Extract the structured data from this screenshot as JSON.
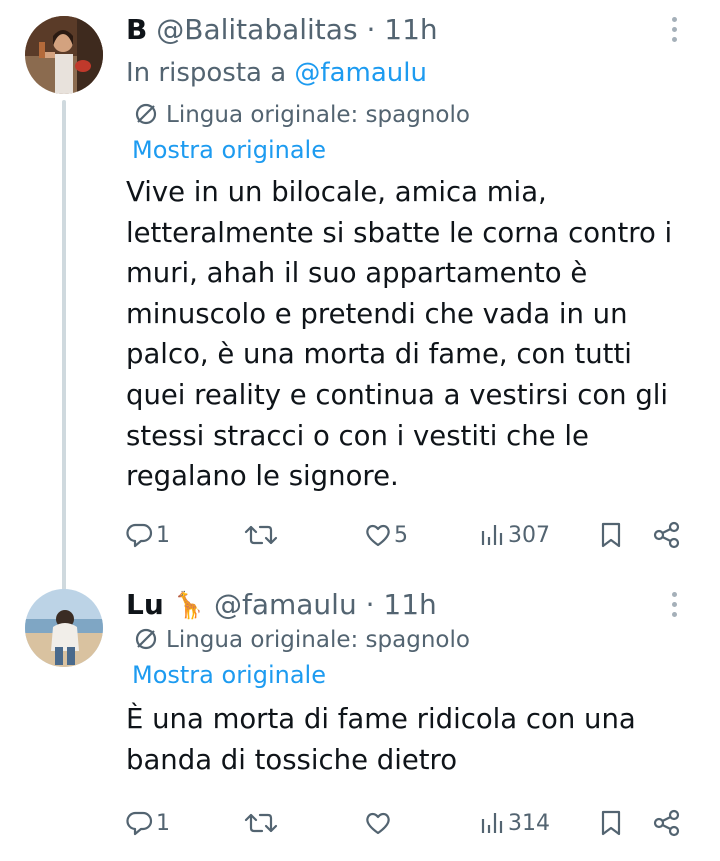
{
  "tweets": [
    {
      "avatar_icon": "woman-drinking-photo-avatar",
      "name": "B",
      "handle": "@Balitabalitas",
      "separator": "·",
      "time": "11h",
      "reply_prefix": "In risposta a",
      "reply_handle": "@famaulu",
      "language_note": "Lingua originale: spagnolo",
      "show_original": "Mostra originale",
      "text": "Vive in un bilocale, amica mia, letteralmente si sbatte le corna contro i muri, ahah il suo appartamento è minuscolo e pretendi che vada in un palco, è una morta di fame, con tutti quei reality e continua a vestirsi con gli stessi stracci o con i vestiti che le regalano le signore.",
      "replies": "1",
      "retweets": "",
      "likes": "5",
      "views": "307"
    },
    {
      "avatar_icon": "person-on-beach-photo-avatar",
      "name": "Lu",
      "name_emoji": "🦒",
      "handle": "@famaulu",
      "separator": "·",
      "time": "11h",
      "language_note": "Lingua originale: spagnolo",
      "show_original": "Mostra originale",
      "text": "È una morta di fame ridicola con una banda di tossiche dietro",
      "replies": "1",
      "retweets": "",
      "likes": "",
      "views": "314"
    }
  ],
  "colors": {
    "accent": "#1d9bf0",
    "secondary_text": "#536471",
    "thread_line": "#cfd9de"
  }
}
